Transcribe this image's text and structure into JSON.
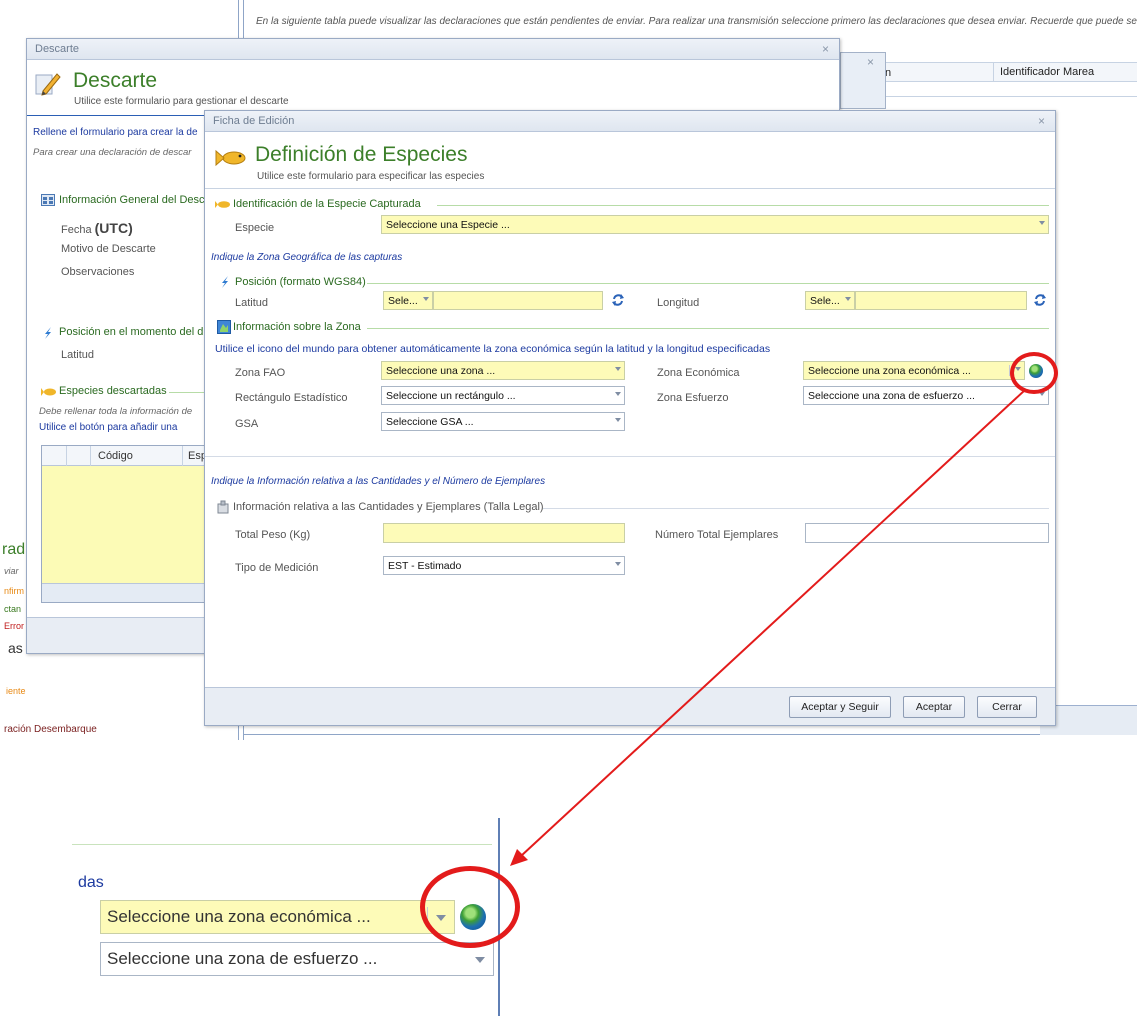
{
  "background_window": {
    "info_text": "En la siguiente tabla puede visualizar las declaraciones que están pendientes de enviar. Para realizar una transmisión seleccione primero las declaraciones que desea enviar. Recuerde que puede sele",
    "grid_col_partial": "n",
    "grid_col_id": "Identificador Marea",
    "left_fragments": [
      "rad",
      "viar",
      "nfirm",
      "ctan",
      "Error",
      "as",
      "iente",
      "ración Desembarque"
    ]
  },
  "descarte": {
    "window_title": "Descarte",
    "heading": "Descarte",
    "subtitle": "Utilice este formulario para gestionar el descarte",
    "instruction": "Rellene el formulario para crear la de",
    "note": "Para crear una declaración de descar",
    "info_general": "Información General del Desc",
    "fecha_label": "Fecha",
    "utc": "(UTC)",
    "motivo": "Motivo de Descarte",
    "observaciones": "Observaciones",
    "posicion": "Posición en el momento del d",
    "latitud": "Latitud",
    "especies": "Especies descartadas",
    "debe_rellenar": "Debe rellenar toda la información de",
    "utilice_boton": "Utilice el botón para añadir una",
    "grid_codigo": "Código",
    "grid_esp": "Esp"
  },
  "ficha": {
    "window_title": "Ficha de Edición",
    "heading": "Definición de Especies",
    "subtitle": "Utilice este formulario para especificar las especies",
    "sec_identificacion": "Identificación de la Especie Capturada",
    "especie_label": "Especie",
    "especie_value": "Seleccione una Especie ...",
    "zona_geo_hint": "Indique la Zona Geográfica de las capturas",
    "sec_posicion": "Posición (formato WGS84)",
    "latitud_label": "Latitud",
    "latitud_hemi": "Sele...",
    "longitud_label": "Longitud",
    "longitud_hemi": "Sele...",
    "sec_zona": "Información sobre la Zona",
    "zona_hint": "Utilice el icono del mundo para obtener automáticamente la zona económica según la latitud y la longitud especificadas",
    "zona_fao_label": "Zona FAO",
    "zona_fao_value": "Seleccione una zona ...",
    "zona_eco_label": "Zona Económica",
    "zona_eco_value": "Seleccione una zona económica ...",
    "rect_label": "Rectángulo Estadístico",
    "rect_value": "Seleccione un rectángulo ...",
    "zona_esf_label": "Zona Esfuerzo",
    "zona_esf_value": "Seleccione una zona de esfuerzo ...",
    "gsa_label": "GSA",
    "gsa_value": "Seleccione GSA ...",
    "cantidades_hint": "Indique la Información relativa a las Cantidades y el Número de Ejemplares",
    "sec_cantidades": "Información relativa a las Cantidades y Ejemplares (Talla Legal)",
    "peso_label": "Total Peso (Kg)",
    "ejemplares_label": "Número Total Ejemplares",
    "medicion_label": "Tipo de Medición",
    "medicion_value": "EST - Estimado",
    "btn_aceptar_seguir": "Aceptar y Seguir",
    "btn_aceptar": "Aceptar",
    "btn_cerrar": "Cerrar"
  },
  "zoom": {
    "label_fragment": "das",
    "zona_eco_value": "Seleccione una zona económica ...",
    "zona_esf_value": "Seleccione una zona de esfuerzo ..."
  },
  "colors": {
    "highlight": "#e31b1b",
    "field_yellow": "#fdfbb8",
    "heading_green": "#3c7f2a",
    "hint_blue": "#1c3aa0"
  }
}
